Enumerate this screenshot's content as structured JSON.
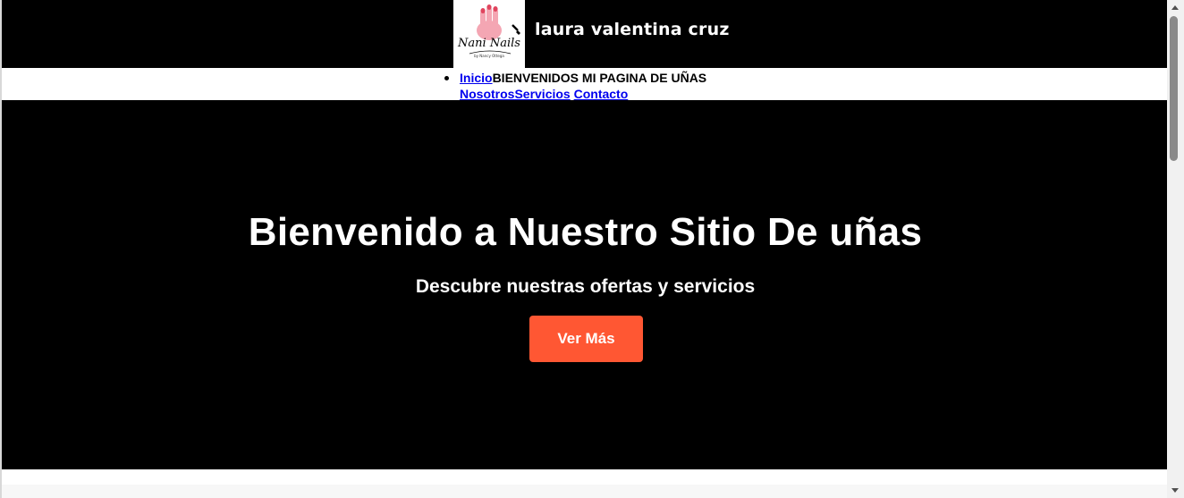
{
  "header": {
    "logo": {
      "brand_text": "Nani Nails",
      "tagline": "by Nancy Ottega"
    },
    "site_title": "laura valentina cruz"
  },
  "nav": {
    "items": [
      {
        "label": "Inicio"
      },
      {
        "label": "BIENVENIDOS MI PAGINA DE UÑAS"
      },
      {
        "label": "Nosotros"
      },
      {
        "label": "Servicios"
      },
      {
        "label": "Contacto"
      }
    ]
  },
  "hero": {
    "title": "Bienvenido a Nuestro Sitio De uñas",
    "subtitle": "Descubre nuestras ofertas y servicios",
    "button_label": "Ver Más"
  },
  "colors": {
    "header_bg": "#000000",
    "hero_bg": "#000000",
    "button_bg": "#ff5733",
    "link": "#0000ee"
  }
}
